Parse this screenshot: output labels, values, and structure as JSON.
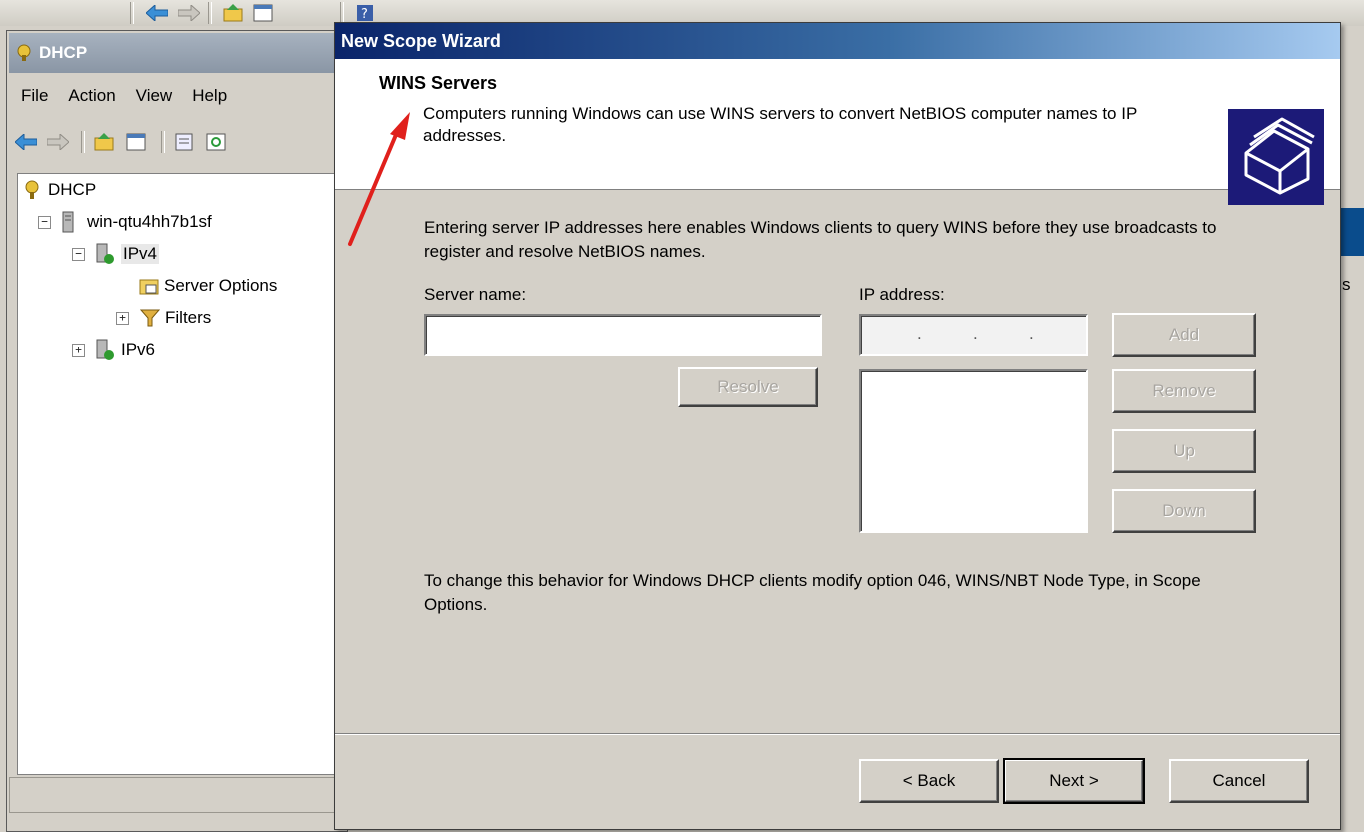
{
  "console": {
    "title": "DHCP",
    "menu": [
      "File",
      "Action",
      "View",
      "Help"
    ],
    "tree": {
      "root": "DHCP",
      "server": "win-qtu4hh7b1sf",
      "ipv4": "IPv4",
      "server_options": "Server Options",
      "filters": "Filters",
      "ipv6": "IPv6"
    },
    "right_edge_letter": "s"
  },
  "wizard": {
    "title": "New Scope Wizard",
    "page_title": "WINS Servers",
    "page_subtitle": "Computers running Windows can use WINS servers to convert NetBIOS computer names to IP addresses.",
    "intro": "Entering server IP addresses here enables Windows clients to query WINS before they use broadcasts to register and resolve NetBIOS names.",
    "server_name_label": "Server name:",
    "server_name_value": "",
    "ip_address_label": "IP address:",
    "ip_address_value": ". . .",
    "buttons": {
      "resolve": "Resolve",
      "add": "Add",
      "remove": "Remove",
      "up": "Up",
      "down": "Down",
      "back": "< Back",
      "next": "Next >",
      "cancel": "Cancel"
    },
    "note": "To change this behavior for Windows DHCP clients modify option 046, WINS/NBT Node Type, in Scope Options."
  },
  "colors": {
    "title_bar_start": "#0a246a",
    "title_bar_end": "#a6caf0",
    "annotation_arrow": "#e0201c"
  }
}
